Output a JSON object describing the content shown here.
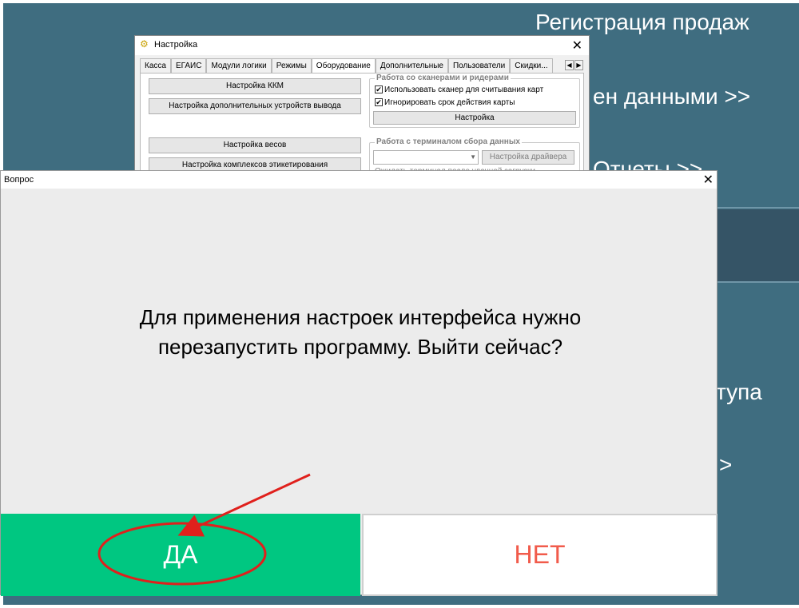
{
  "app": {
    "menu_items": [
      "Регистрация продаж",
      "ен данными >>",
      "Отчеты >>",
      "ступа",
      ">"
    ],
    "accent": "#3f6d80"
  },
  "settings_window": {
    "title": "Настройка",
    "tabs": [
      "Касса",
      "ЕГАИС",
      "Модули логики",
      "Режимы",
      "Оборудование",
      "Дополнительные",
      "Пользователи",
      "Скидки..."
    ],
    "active_tab": "Оборудование",
    "buttons": {
      "kkm": "Настройка ККМ",
      "extra_output": "Настройка дополнительных устройств вывода",
      "scales": "Настройка весов",
      "labeling": "Настройка комплексов этикетирования"
    },
    "scanners_group": {
      "title": "Работа со сканерами и ридерами",
      "use_scanner": "Использовать сканер для считывания карт",
      "ignore_expiry": "Игнорировать срок действия карты",
      "settings_button": "Настройка"
    },
    "terminal_group": {
      "title": "Работа с терминалом сбора данных",
      "driver_button": "Настройка драйвера",
      "wait_option": "Ожидать терминал после удачной загрузки"
    }
  },
  "dialog": {
    "title": "Вопрос",
    "message_line1": "Для применения настроек интерфейса нужно",
    "message_line2": "перезапустить программу. Выйти сейчас?",
    "yes_label": "ДА",
    "no_label": "НЕТ",
    "yes_color": "#00c781",
    "no_color": "#f15b4b"
  },
  "annotation": {
    "color": "#e0201c"
  }
}
